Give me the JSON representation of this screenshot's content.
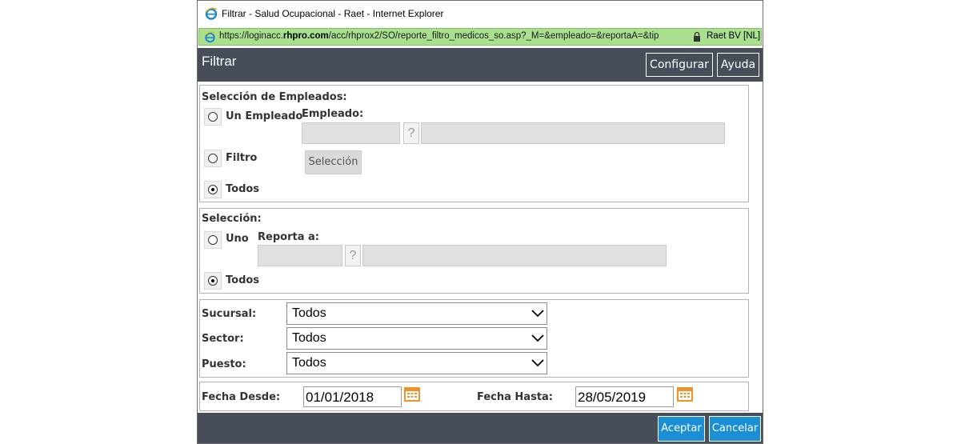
{
  "window": {
    "title": "Filtrar - Salud Ocupacional - Raet - Internet Explorer",
    "minimize_glyph": "—",
    "maximize_glyph": "☐",
    "close_glyph": "✕"
  },
  "address_bar": {
    "protocol": "https://",
    "host_prefix": "loginacc.",
    "host_bold": "rhpro.com",
    "path": "/acc/rhprox2/SO/reporte_filtro_medicos_so.asp?_M=&empleado=&reportaA=&tip",
    "certificate": "Raet BV [NL]"
  },
  "header": {
    "title": "Filtrar",
    "configurar_label": "Configurar",
    "ayuda_label": "Ayuda"
  },
  "empleados": {
    "legend": "Selección de Empleados:",
    "un_empleado_label": "Un Empleado",
    "empleado_field_label": "Empleado:",
    "help_glyph": "?",
    "filtro_label": "Filtro",
    "seleccion_button": "Selección",
    "todos_label": "Todos",
    "selected": "Todos"
  },
  "seleccion": {
    "legend": "Selección:",
    "uno_label": "Uno",
    "reporta_label": "Reporta a:",
    "help_glyph": "?",
    "todos_label": "Todos",
    "selected": "Todos"
  },
  "filters": {
    "sucursal_label": "Sucursal:",
    "sucursal_value": "Todos",
    "sector_label": "Sector:",
    "sector_value": "Todos",
    "puesto_label": "Puesto:",
    "puesto_value": "Todos"
  },
  "fechas": {
    "desde_label": "Fecha Desde:",
    "desde_value": "01/01/2018",
    "hasta_label": "Fecha Hasta:",
    "hasta_value": "28/05/2019"
  },
  "footer": {
    "aceptar_label": "Aceptar",
    "cancelar_label": "Cancelar"
  },
  "colors": {
    "header_bg": "#474d59",
    "address_bg": "#a8e08e",
    "primary_button": "#1a8fd6",
    "calendar_icon": "#f0932b"
  }
}
